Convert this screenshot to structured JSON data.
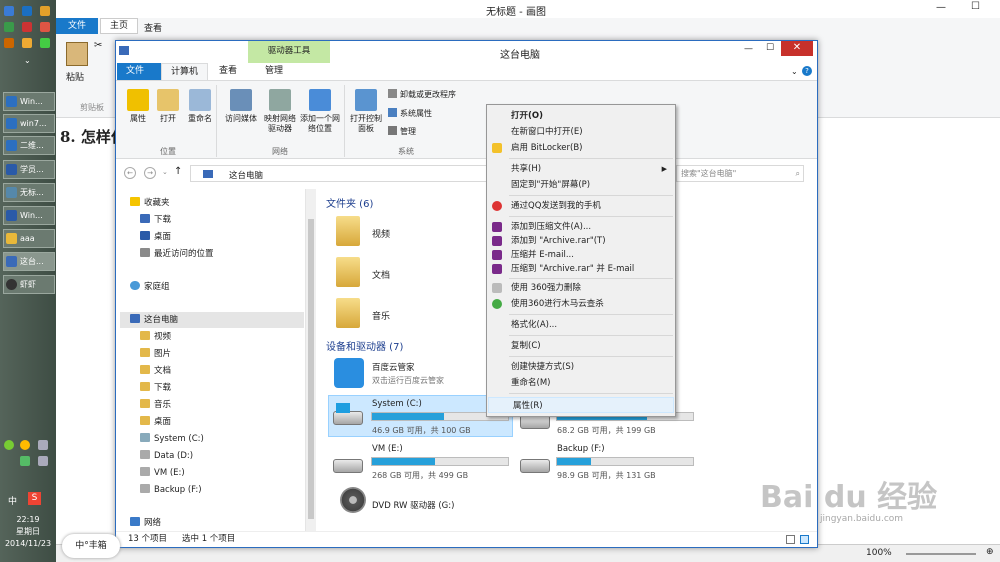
{
  "paint": {
    "title": "无标题 - 画图",
    "tab_file": "文件",
    "tab_home": "主页",
    "tab_view": "查看",
    "paste": "粘贴",
    "clipboard": "剪贴板",
    "canvas_text": "8. 怎样付",
    "zoom": "100%"
  },
  "taskbar": {
    "items": [
      "Win...",
      "win7...",
      "二维...",
      "学员...",
      "无标...",
      "Win...",
      "aaa",
      "这台...",
      "虾虾"
    ],
    "ime1": "中",
    "ime2": "S",
    "time": "22:19",
    "day": "星期日",
    "date": "2014/11/23"
  },
  "explorer": {
    "title": "这台电脑",
    "tool_tab": "驱动器工具",
    "tabs": [
      "文件",
      "计算机",
      "查看",
      "管理"
    ],
    "ribbon": {
      "properties": "属性",
      "open": "打开",
      "rename": "重命名",
      "access_media": "访问媒体",
      "map_drive": "映射网络驱动器",
      "add_location": "添加一个网络位置",
      "open_control": "打开控制面板",
      "uninstall": "卸载或更改程序",
      "sys_props": "系统属性",
      "manage": "管理",
      "grp_location": "位置",
      "grp_network": "网络",
      "grp_system": "系统"
    },
    "address": "这台电脑",
    "search_placeholder": "搜索\"这台电脑\"",
    "nav": [
      "收藏夹",
      "下载",
      "桌面",
      "最近访问的位置",
      "家庭组",
      "这台电脑",
      "视频",
      "图片",
      "文档",
      "下载",
      "音乐",
      "桌面",
      "System (C:)",
      "Data (D:)",
      "VM (E:)",
      "Backup (F:)",
      "网络"
    ],
    "folders_header": "文件夹 (6)",
    "folders": [
      "视频",
      "文档",
      "音乐"
    ],
    "drives_header": "设备和驱动器 (7)",
    "baidu_name": "百度云管家",
    "baidu_desc": "双击运行百度云管家",
    "drives": [
      {
        "name": "System (C:)",
        "free": "46.9 GB 可用，共 100 GB",
        "used": 0.53
      },
      {
        "name": "",
        "free": "68.2 GB 可用，共 199 GB",
        "used": 0.66
      },
      {
        "name": "VM (E:)",
        "free": "268 GB 可用，共 499 GB",
        "used": 0.46
      },
      {
        "name": "Backup (F:)",
        "free": "98.9 GB 可用，共 131 GB",
        "used": 0.25
      }
    ],
    "dvd": "DVD RW 驱动器 (G:)",
    "status_count": "13 个项目",
    "status_sel": "选中 1 个项目"
  },
  "menu": {
    "items": [
      "打开(O)",
      "在新窗口中打开(E)",
      "启用 BitLocker(B)",
      "共享(H)",
      "固定到\"开始\"屏幕(P)",
      "通过QQ发送到我的手机",
      "添加到压缩文件(A)...",
      "添加到 \"Archive.rar\"(T)",
      "压缩并 E-mail...",
      "压缩到 \"Archive.rar\" 并 E-mail",
      "使用 360强力删除",
      "使用360进行木马云查杀",
      "格式化(A)...",
      "复制(C)",
      "创建快捷方式(S)",
      "重命名(M)",
      "属性(R)"
    ]
  },
  "watermark": {
    "brand": "Bai du 经验",
    "url": "jingyan.baidu.com",
    "stamp": "中°丰箱"
  }
}
